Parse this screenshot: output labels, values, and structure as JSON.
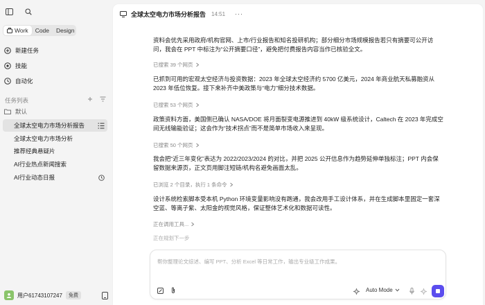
{
  "sidebar": {
    "segments": [
      {
        "label": "Work",
        "active": true
      },
      {
        "label": "Code",
        "active": false
      },
      {
        "label": "Design",
        "active": false
      }
    ],
    "nav": {
      "new_task": "新建任务",
      "skills": "技能",
      "automation": "自动化"
    },
    "section_label": "任务列表",
    "folder_label": "默认",
    "tasks": [
      {
        "label": "全球太空电力市场分析报告",
        "active": true
      },
      {
        "label": "全球太空电力市场分析",
        "active": false
      },
      {
        "label": "推荐经典悬疑片",
        "active": false
      },
      {
        "label": "AI行业热点新闻搜索",
        "active": false
      },
      {
        "label": "AI行业动态日报",
        "active": false
      }
    ],
    "user": {
      "name": "用户61743107247",
      "plan": "免费"
    }
  },
  "header": {
    "title": "全球太空电力市场分析报告",
    "time": "14:51",
    "more": "···"
  },
  "messages": {
    "p1": "资料会优先采用政府/机构官网、上市/行业报告和知名投研机构；部分细分市场规模报告若只有摘要可公开访问，我会在 PPT 中标注为“公开摘要口径”，避免把付费报告内容当作已核验全文。",
    "s1": "已搜索 39 个网页",
    "p2": "已抓到可用的宏观太空经济与投资数据：2023 年全球太空经济约 5700 亿美元，2024 年商业航天私募融资从 2023 年低位恢复。接下来补齐中美政策与“电力”细分技术数据。",
    "s2": "已搜索 53 个网页",
    "p3": "政策资料方面，美国侧已确认 NASA/DOE 将月面裂变电源推进到 40kW 级系统设计，Caltech 在 2023 年完成空间无线输能验证；这会作为“技术拐点”而不是简单市场收入来呈现。",
    "s3": "已搜索 50 个网页",
    "p4": "我会把“近三年变化”表达为 2022/2023/2024 的对比，并把 2025 公开信息作为趋势延伸单独标注；PPT 内会保留数据来源页，正文页用脚注短链/机构名避免画面太乱。",
    "s4": "已浏览 2 个目录，执行 1 条命令",
    "p5": "设计系统检索脚本受本机 Python 环境变量影响没有跑通，我会改用手工设计体系，并在生成脚本里固定一套深空蓝、等离子紫、太阳金的视觉风格，保证整体艺术化和数据可读性。",
    "s5": "正在调用工具...",
    "s6": "正在规划下一步"
  },
  "composer": {
    "placeholder": "帮你整理论文综述、编写 PPT、分析 Excel 等日常工作，输出专业级工作成果。",
    "mode": "Auto Mode"
  },
  "colors": {
    "accent": "#5b4dee",
    "avatar": "#8ac46a"
  },
  "icons": [
    "sidebar-toggle-icon",
    "search-icon",
    "briefcase-icon",
    "new-task-icon",
    "skills-icon",
    "automation-icon",
    "collapse-icon",
    "filter-icon",
    "folder-icon",
    "list-icon",
    "clock-icon",
    "panel-icon",
    "chevron-right-icon",
    "monitor-icon",
    "attach-icon",
    "paperclip-icon",
    "sparkle-icon",
    "chevron-down-icon",
    "mic-icon",
    "sparkle-faint-icon",
    "stop-icon"
  ]
}
